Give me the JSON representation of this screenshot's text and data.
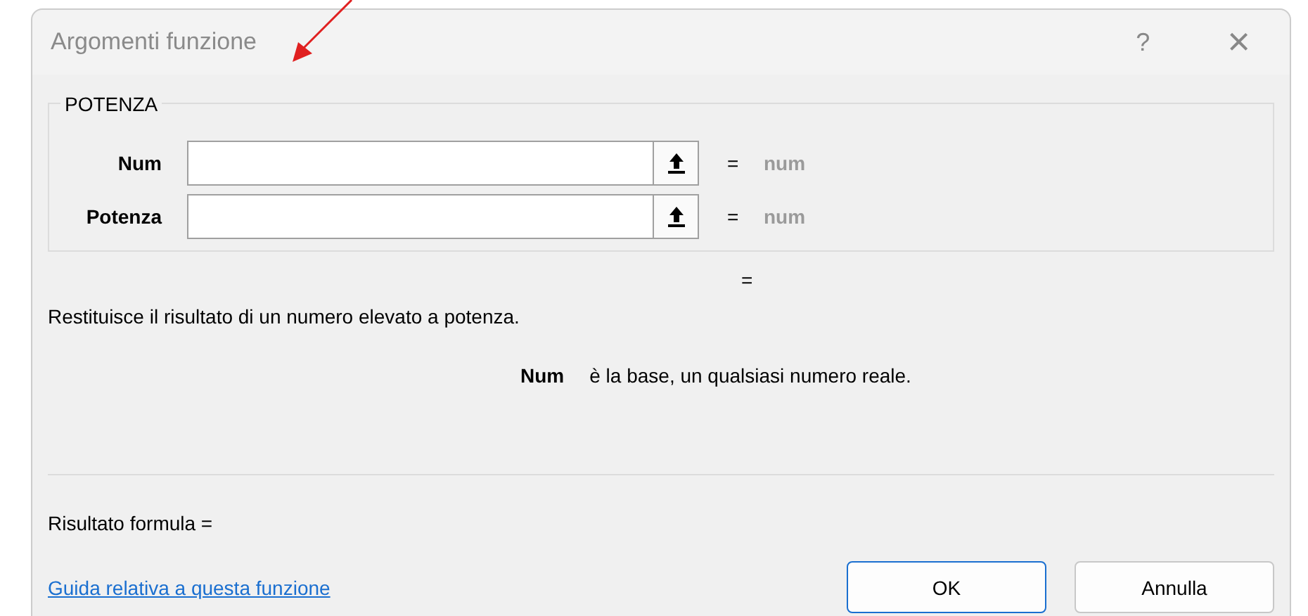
{
  "window": {
    "title": "Argomenti funzione",
    "help": "?",
    "close": "×"
  },
  "group": {
    "title": "POTENZA",
    "arguments": [
      {
        "label": "Num",
        "equals": "=",
        "result": "num"
      },
      {
        "label": "Potenza",
        "equals": "=",
        "result": "num"
      }
    ]
  },
  "total_equals": "=",
  "description": "Restituisce il risultato di un numero elevato a potenza.",
  "argument_help": {
    "name": "Num",
    "text": "è la base, un qualsiasi numero reale."
  },
  "formula_result": "Risultato formula =",
  "help_link": "Guida relativa a questa funzione",
  "buttons": [
    {
      "label": "OK",
      "kind": "default"
    },
    {
      "label": "Annulla",
      "kind": "normal"
    }
  ]
}
